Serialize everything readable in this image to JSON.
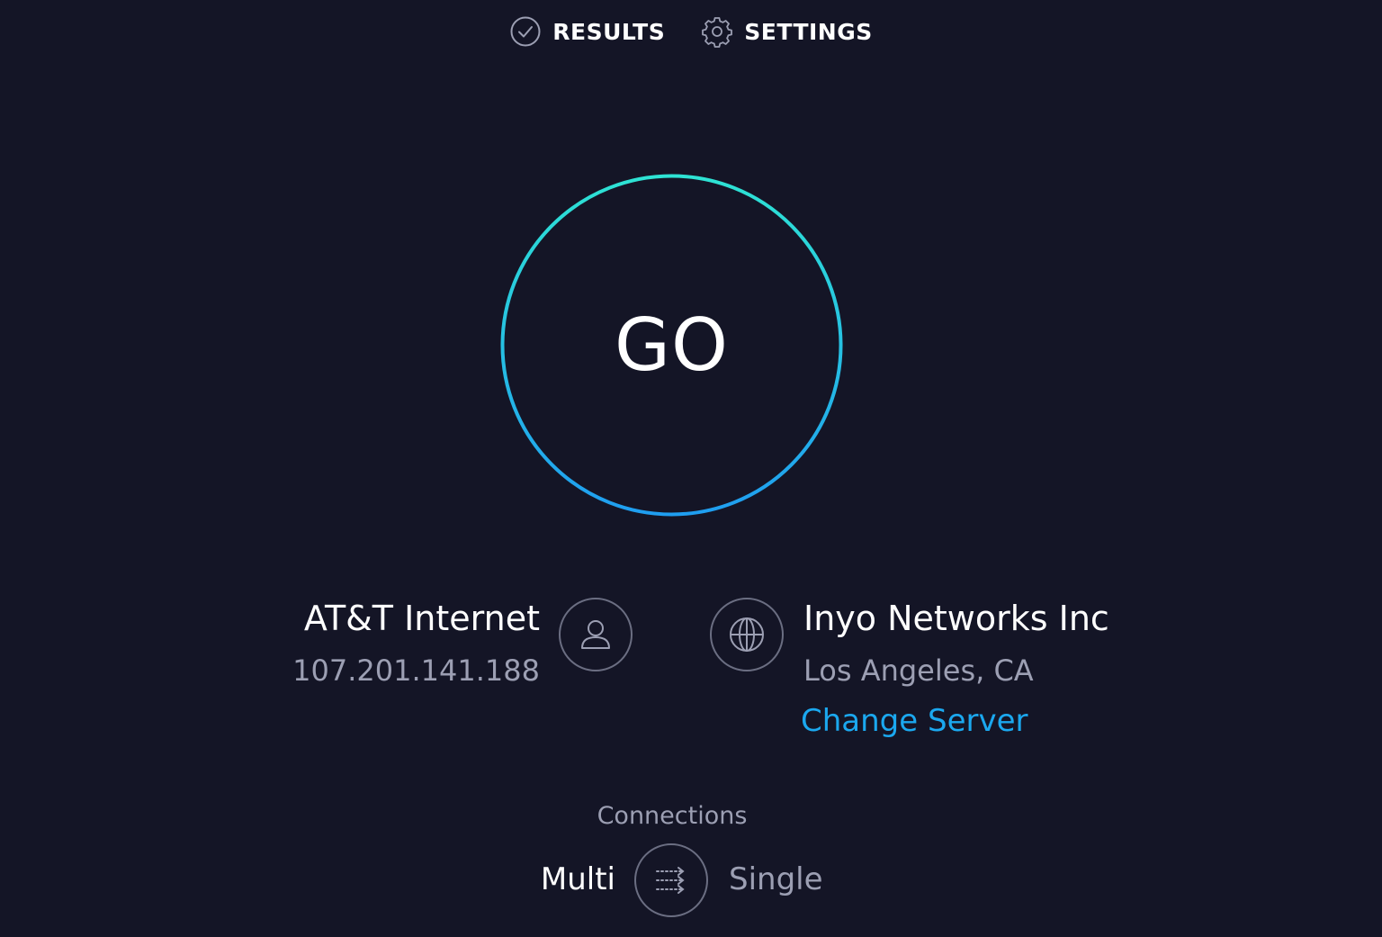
{
  "nav": {
    "results_label": "RESULTS",
    "settings_label": "SETTINGS",
    "results_icon": "check-circle-icon",
    "settings_icon": "gear-icon"
  },
  "go_button": {
    "label": "GO",
    "ring_gradient": [
      "#2ee3d4",
      "#1f9ef0"
    ]
  },
  "isp": {
    "name": "AT&T Internet",
    "ip": "107.201.141.188",
    "icon": "user-icon"
  },
  "server": {
    "name": "Inyo Networks Inc",
    "location": "Los Angeles, CA",
    "change_label": "Change Server",
    "icon": "globe-icon"
  },
  "connections": {
    "title": "Connections",
    "multi_label": "Multi",
    "single_label": "Single",
    "selected": "Multi",
    "icon": "connections-icon"
  },
  "colors": {
    "background": "#141526",
    "accent": "#1ba8ef",
    "muted_text": "#9c9fb3"
  }
}
